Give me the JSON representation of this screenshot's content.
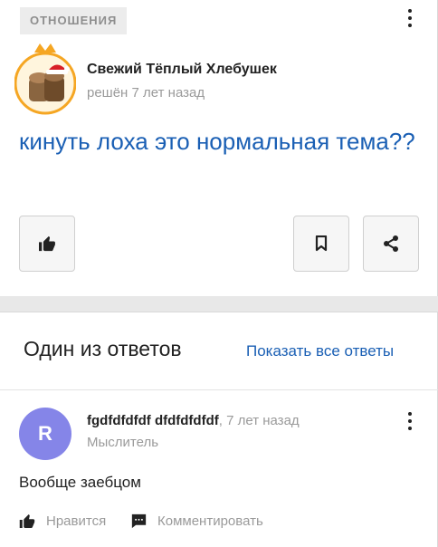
{
  "question": {
    "category": "ОТНОШЕНИЯ",
    "author_name": "Свежий Тёплый Хлебушек",
    "status": "решён 7 лет назад",
    "title": "кинуть лоха это нормальная тема??",
    "actions": {
      "like_icon": "thumbs-up-icon",
      "bookmark_icon": "bookmark-icon",
      "share_icon": "share-icon"
    }
  },
  "answers_section": {
    "heading": "Один из ответов",
    "show_all_label": "Показать все ответы"
  },
  "answer": {
    "avatar_letter": "R",
    "avatar_color": "#8585e8",
    "author_name": "fgdfdfdfdf dfdfdfdfdf",
    "time": ", 7 лет назад",
    "rank": "Мыслитель",
    "text": "Вообще заебцом",
    "like_label": "Нравится",
    "comment_label": "Комментировать"
  },
  "colors": {
    "link": "#1a5fb4",
    "muted": "#9a9a9a",
    "accent_crown": "#f5a623"
  }
}
